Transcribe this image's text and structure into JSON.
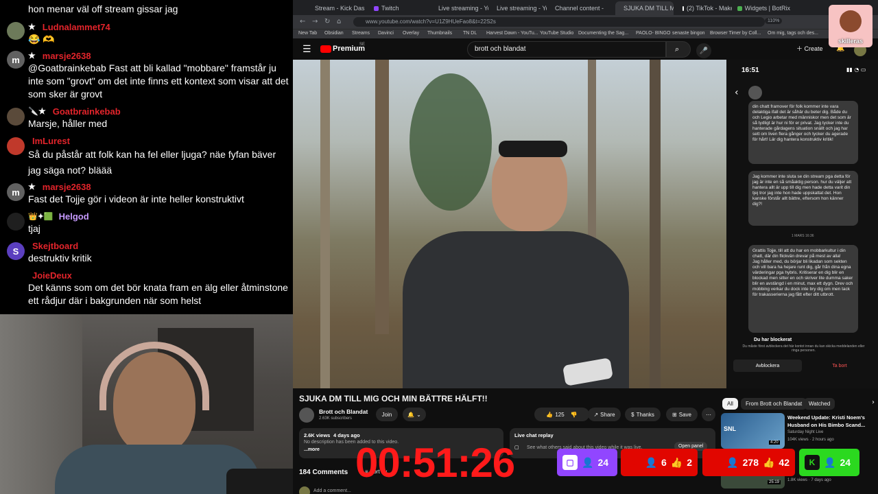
{
  "chat": {
    "messages": [
      {
        "user": "",
        "text": "hon menar väl off stream gissar jag",
        "badges": ""
      },
      {
        "user": "Ludnalammet74",
        "text": "😂 🫶",
        "badges": "★"
      },
      {
        "user": "marsje2638",
        "text": "@Goatbrainkebab Fast att bli kallad \"mobbare\" framstår ju inte som \"grovt\" om det inte finns ett kontext som visar att det som sker är grovt",
        "badges": "★",
        "avatar": "m"
      },
      {
        "user": "Goatbrainkebab",
        "text": "Marsje, håller med",
        "badges": "🔪★"
      },
      {
        "user": "ImLurest",
        "text": "Så du påstår att folk kan ha fel eller ljuga? näe fyfan bäver jag säga not? bläää",
        "badges": ""
      },
      {
        "user": "marsje2638",
        "text": "Fast det Tojje gör i videon är inte heller konstruktivt",
        "badges": "★",
        "avatar": "m"
      },
      {
        "user": "Helgod",
        "text": "tjaj",
        "badges": "👑✦🟩"
      },
      {
        "user": "Skejtboard",
        "text": "destruktiv kritik",
        "badges": "",
        "avatar": "S"
      },
      {
        "user": "JoieDeux",
        "text": "Det känns som om det bör knata fram en älg eller åtminstone ett rådjur där i bakgrunden när som helst",
        "badges": ""
      }
    ]
  },
  "browser": {
    "tabs": [
      "Stream - Kick Dashbo",
      "Twitch",
      "Live streaming - YouT",
      "Live streaming - YouT",
      "Channel content - Yo",
      "SJUKA DM TILL M",
      "(2) TikTok - Make You",
      "Widgets | BotRix"
    ],
    "url": "www.youtube.com/watch?v=U1Z9HUeFao8&t=22S2s",
    "zoom": "110%",
    "bookmarks": [
      "New Tab",
      "Obsidian",
      "Streams",
      "Davinci",
      "Overlay",
      "Thumbnails",
      "TN DL",
      "Harvest Dawn - YouTu...",
      "YouTube Studio",
      "Documenting the Sag...",
      "PAOLO- BINGO",
      "senaste bingon",
      "Browser Timer by Coll...",
      "Om mig, tags och des..."
    ]
  },
  "youtube": {
    "logo": "Premium",
    "region": "SE",
    "search_query": "brott och blandat",
    "create_label": "Create",
    "video_title": "SJUKA DM TILL MIG OCH MIN BÄTTRE HÄLFT!!",
    "channel": "Brott och Blandat",
    "subscribers": "2.63K subscribers",
    "join_label": "Join",
    "likes": "125",
    "share_label": "Share",
    "thanks_label": "Thanks",
    "save_label": "Save",
    "views": "2.6K views",
    "age": "4 days ago",
    "description": "No description has been added to this video.",
    "more_label": "...more",
    "live_chat_replay": "Live chat replay",
    "live_chat_desc": "See what others said about this video while it was live.",
    "open_panel": "Open panel",
    "comments_count": "184 Comments",
    "sort_label": "Sort by",
    "add_comment": "Add a comment...",
    "chips": [
      "All",
      "From Brott och Blandat",
      "Watched"
    ],
    "rec_title": "Weekend Update: Kristi Noem's Husband on His Bimbo Scand...",
    "rec_channel": "Saturday Night Live",
    "rec_meta": "104K views · 2 hours ago",
    "rec_duration": "4:20",
    "rec2_duration": "25:19",
    "rec2_meta": "1.8K views · 7 days ago"
  },
  "phone": {
    "time": "16:51",
    "date_label": "1 MARS 16:36",
    "bubbles": [
      "din chatt framover för folk kommer inte vara delaktiga ifall det är såhär du beter dig. Både du och Legio arbetar med människor men det som är så tydligt är hur ni för er privat. Jag tycker inte du hanterade gårdagens situation snällt och jag har sett om liven flera gånger och tycker du agerade för hårt! Lär dig hantera konstruktiv kritik!",
      "Jag kommer inte sluta se din stream pga detta för jag är inte en så småaktig person. hur du väljer att hantera allt är upp till dig men hade detta varit din tjej tror jag inte hon hade uppskattat det. Hon kanske förstår allt bättre, eftersom hon känner dig?!",
      "Grattis Tojje, till att du har en mobbarkultur i din chatt, där din flickvän drevar på mest av alla!\nJag håller med, du börjar bli likadan som sekten och vill bara ha hejare runt dig, går från dina egna värderingar pga hybris. Kritiserar en dig blir en blockad men sitter en och skriver lite dumma saker blir en avstängd i en minut, max ett dygn. Drev och mobbing verkar du dock inte bry dig om men tack för trakasserierna jag fått efter ditt utbrott."
    ],
    "blocked_title": "Du har blockerat",
    "blocked_desc": "Du måste först avblockera det här kontot innan du kan skicka meddelanden eller ringa personen.",
    "unblock": "Avblockera",
    "delete": "Ta bort"
  },
  "overlay": {
    "timer": "00:51:26",
    "counters": [
      {
        "platform": "twitch",
        "viewers": "24",
        "likes": "",
        "color": "#9146ff"
      },
      {
        "platform": "youtube",
        "viewers": "6",
        "likes": "2",
        "color": "#e10600"
      },
      {
        "platform": "youtube",
        "viewers": "278",
        "likes": "42",
        "color": "#e10600"
      },
      {
        "platform": "kick",
        "viewers": "24",
        "likes": "",
        "color": "#2bd91f"
      }
    ],
    "logo_name": "skilleras"
  }
}
